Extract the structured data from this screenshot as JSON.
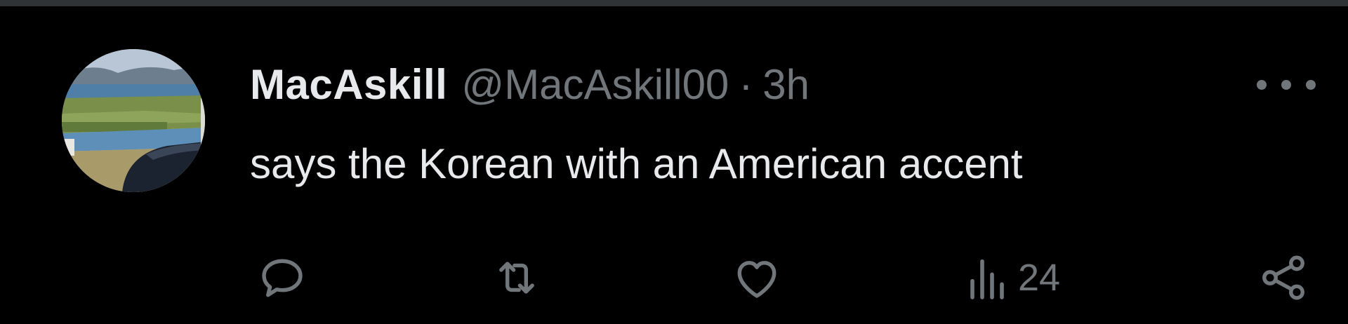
{
  "tweet": {
    "author": {
      "display_name": "MacAskill",
      "handle": "@MacAskill00",
      "avatar_icon": "avatar-landscape-photo"
    },
    "separator": "·",
    "time": "3h",
    "text": "says the Korean with an American accent",
    "more_icon": "more-horizontal-icon"
  },
  "actions": {
    "reply": {
      "icon": "reply-icon"
    },
    "retweet": {
      "icon": "retweet-icon"
    },
    "like": {
      "icon": "heart-icon"
    },
    "views": {
      "icon": "views-icon",
      "count": "24"
    },
    "share": {
      "icon": "share-icon"
    }
  },
  "colors": {
    "background": "#000000",
    "primary_text": "#e7e9ea",
    "secondary_text": "#71767b",
    "divider": "#2f3336"
  }
}
